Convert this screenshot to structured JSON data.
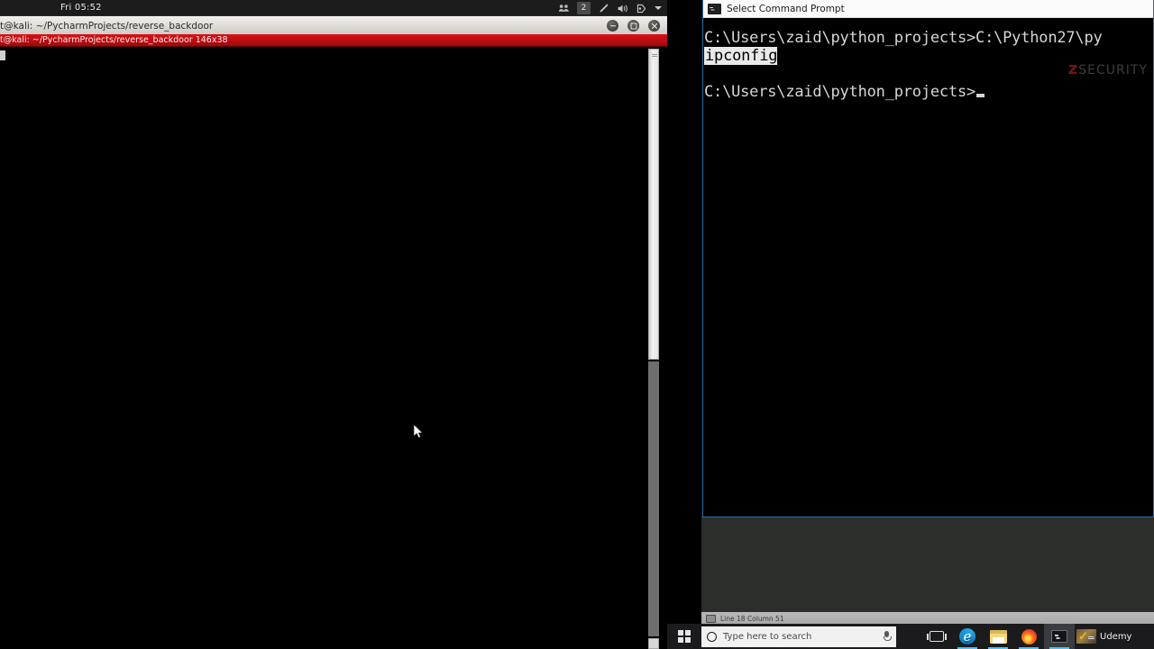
{
  "kali": {
    "panel": {
      "clock": "Fri 05:52",
      "workspace_badge": "2",
      "icons": [
        "users-switch-icon",
        "pen-icon",
        "volume-icon",
        "power-icon",
        "caret-down-icon"
      ]
    },
    "terminal": {
      "window_title": "t@kali: ~/PycharmProjects/reverse_backdoor",
      "tab_title": "t@kali: ~/PycharmProjects/reverse_backdoor 146x38",
      "body_text": "",
      "window_buttons": [
        "minimize",
        "maximize",
        "close"
      ]
    }
  },
  "windows": {
    "cmd": {
      "title": "Select Command Prompt",
      "lines": [
        {
          "text": "C:\\Users\\zaid\\python_projects>C:\\Python27\\py",
          "selected": false
        },
        {
          "text": "ipconfig",
          "selected": true
        },
        {
          "text": "",
          "selected": false
        },
        {
          "text": "C:\\Users\\zaid\\python_projects>",
          "selected": false,
          "caret": true
        }
      ]
    },
    "watermark": {
      "z": "z",
      "rest": "SECURITY"
    },
    "behind_app": {
      "status_text": "Line 18  Column 51"
    },
    "taskbar": {
      "start_label": "start-button",
      "search_placeholder": "Type here to search",
      "search_value": "",
      "items": [
        {
          "name": "task-view",
          "label": ""
        },
        {
          "name": "microsoft-edge",
          "label": ""
        },
        {
          "name": "file-explorer",
          "label": ""
        },
        {
          "name": "firefox",
          "label": ""
        },
        {
          "name": "command-prompt",
          "label": ""
        },
        {
          "name": "udemy",
          "label": "Udemy"
        }
      ]
    }
  },
  "colors": {
    "kali_red": "#c10d12",
    "cmd_border_blue": "#2f6da8",
    "taskbar_bg": "#1b1b1e",
    "taskbar_accent": "#4cc2f1"
  }
}
